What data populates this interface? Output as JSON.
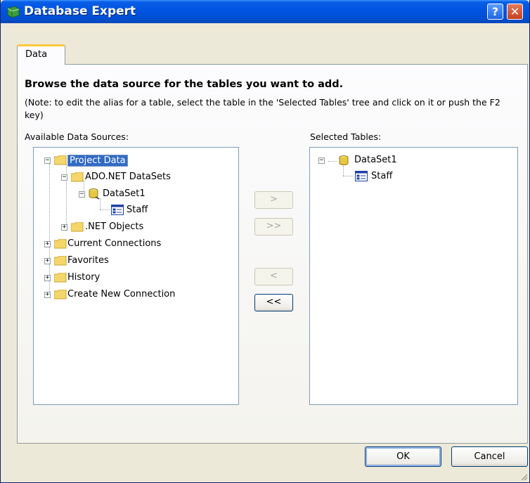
{
  "window": {
    "title": "Database Expert",
    "help_label": "?",
    "close_label": "✕"
  },
  "tabs": [
    {
      "label": "Data"
    }
  ],
  "content": {
    "heading": "Browse the data source for the tables you want to add.",
    "note": "(Note: to edit the alias for a table, select the table in the 'Selected Tables' tree and click on it or push the F2 key)",
    "available_label": "Available Data Sources:",
    "selected_label": "Selected Tables:"
  },
  "available_tree": {
    "project_data": "Project Data",
    "ado_net_datasets": "ADO.NET DataSets",
    "dataset1": "DataSet1",
    "staff": "Staff",
    "net_objects": ".NET Objects",
    "current_connections": "Current Connections",
    "favorites": "Favorites",
    "history": "History",
    "create_new_connection": "Create New Connection"
  },
  "selected_tree": {
    "dataset1": "DataSet1",
    "staff": "Staff"
  },
  "move_buttons": {
    "add": ">",
    "add_all": ">>",
    "remove": "<",
    "remove_all": "<<"
  },
  "footer": {
    "ok": "OK",
    "cancel": "Cancel"
  },
  "colors": {
    "titlebar": "#0054e3",
    "selection": "#316ac5",
    "tab_highlight": "#ffc83c",
    "folder": "#f5d66a"
  }
}
